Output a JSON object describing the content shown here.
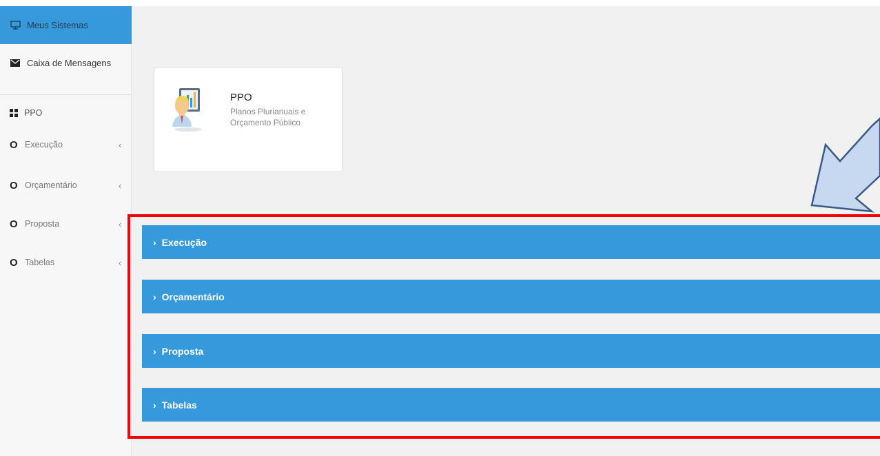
{
  "sidebar": {
    "meus_sistemas": "Meus Sistemas",
    "caixa_mensagens": "Caixa de Mensagens",
    "module_title": "PPO",
    "menu": [
      {
        "label": "Execução",
        "bullet": "O",
        "chevron": "‹"
      },
      {
        "label": "Orçamentário",
        "bullet": "O",
        "chevron": "‹"
      },
      {
        "label": "Proposta",
        "bullet": "O",
        "chevron": "‹"
      },
      {
        "label": "Tabelas",
        "bullet": "O",
        "chevron": "‹"
      }
    ]
  },
  "card": {
    "title": "PPO",
    "subtitle": "Planos Plurianuais e Orçamento Público",
    "icon": "analyst-chart-icon"
  },
  "accordion": [
    {
      "label": "Execução",
      "arrow": "›"
    },
    {
      "label": "Orçamentário",
      "arrow": "›"
    },
    {
      "label": "Proposta",
      "arrow": "›"
    },
    {
      "label": "Tabelas",
      "arrow": "›"
    }
  ],
  "colors": {
    "accent": "#3699dc",
    "highlight_border": "#f30000",
    "annotation_arrow_fill": "#c7d9f1",
    "annotation_arrow_stroke": "#3a5a85"
  }
}
